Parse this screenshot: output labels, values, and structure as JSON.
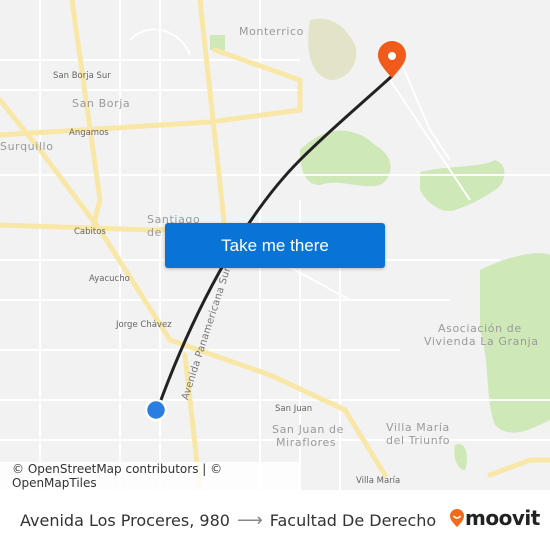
{
  "map": {
    "labels": {
      "monterrico": "Monterrico",
      "san_borja_sur": "San Borja Sur",
      "san_borja": "San Borja",
      "angamos": "Angamos",
      "surquillo": "Surquillo",
      "cabitos": "Cabitos",
      "santiago_de_surco_1": "Santiago",
      "santiago_de_surco_2": "de S",
      "ayacucho": "Ayacucho",
      "jorge_chavez": "Jorge Chávez",
      "panamericana": "Avenida Panamericana Sur",
      "san_juan": "San Juan",
      "sjm_1": "San Juan de",
      "sjm_2": "Miraflores",
      "vmt_1": "Villa María",
      "vmt_2": "del Triunfo",
      "villa_maria": "Villa María",
      "granja_1": "Asociación de",
      "granja_2": "Vivienda La Granja"
    },
    "colors": {
      "route": "#222222",
      "origin": "#2a7de1",
      "destination": "#f05a1a",
      "major_road": "#f8e7a6",
      "park": "#cfe8b8"
    }
  },
  "cta": {
    "label": "Take me there"
  },
  "attribution": "© OpenStreetMap contributors | © OpenMapTiles",
  "footer": {
    "origin": "Avenida Los Proceres, 980",
    "arrow": "⟶",
    "destination": "Facultad De Derecho",
    "brand": "moovit",
    "brand_color": "#f26b1d"
  }
}
